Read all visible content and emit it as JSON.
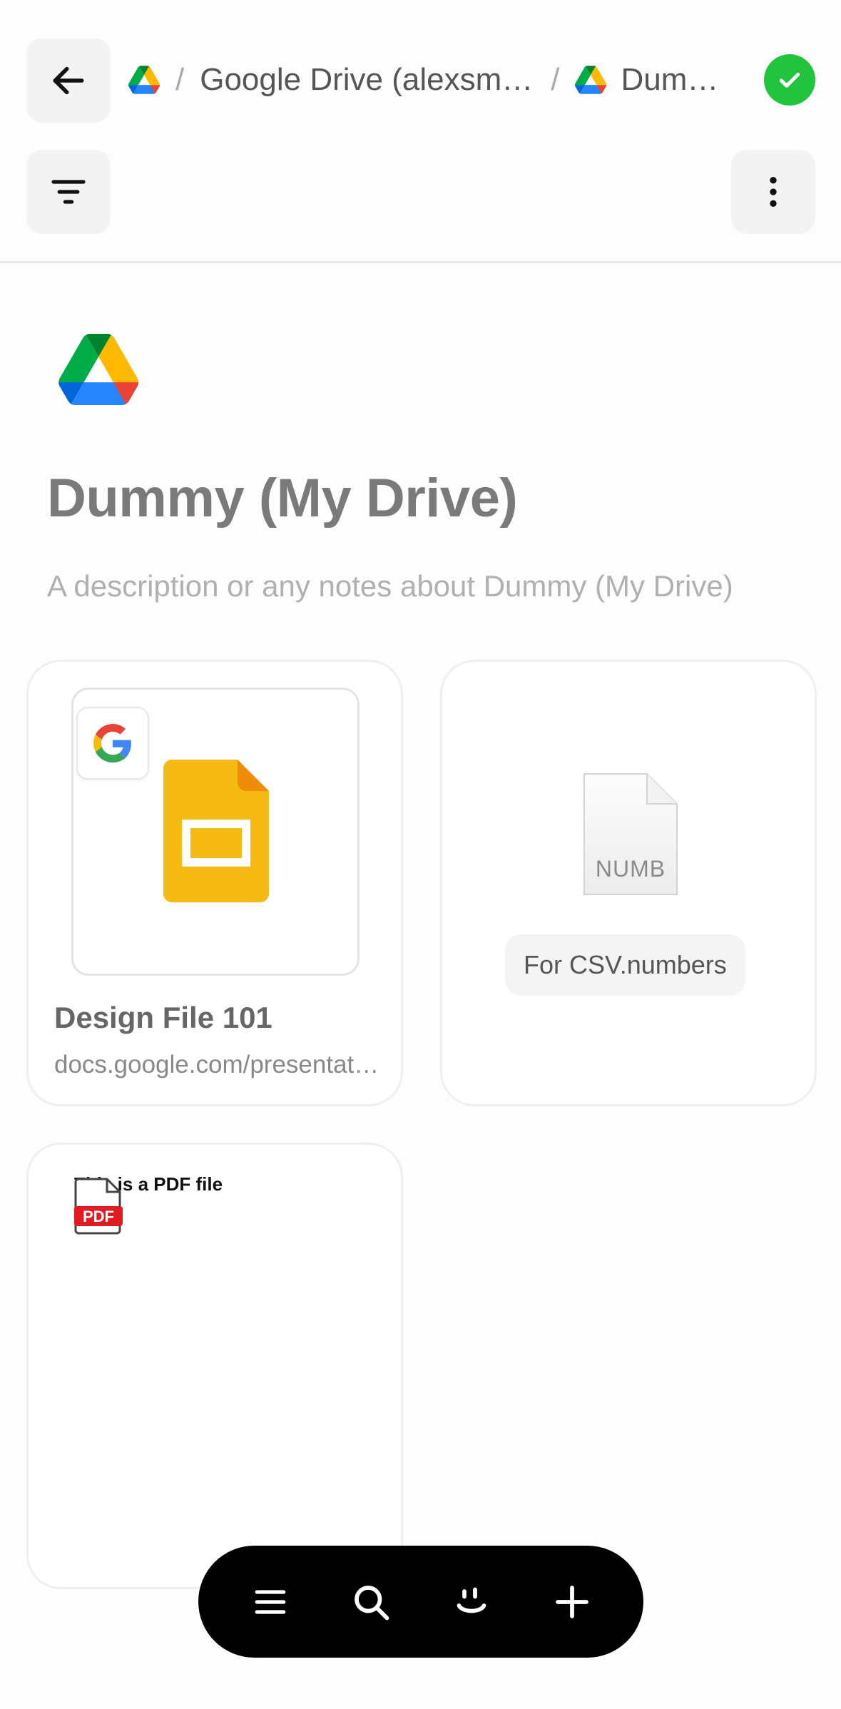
{
  "header": {
    "breadcrumbs": [
      {
        "label": "",
        "icon": "google-drive-icon"
      },
      {
        "label": "Google Drive (alexsmith.mobbin@gmail.com)",
        "icon": ""
      },
      {
        "label": "Dummy (My Drive)",
        "icon": "google-drive-icon"
      }
    ],
    "separator": "/",
    "status_icon": "check-circle-icon",
    "status_color": "#22c33d"
  },
  "page": {
    "title": "Dummy (My Drive)",
    "description_placeholder": "A description or any notes about Dummy (My Drive)"
  },
  "cards": [
    {
      "title": "Design File 101",
      "url": "docs.google.com/presentation",
      "icon": "google-slides-icon",
      "badge": "google-g-icon"
    },
    {
      "file_type_label": "NUMB",
      "chip_label": "For CSV.numbers",
      "icon": "numbers-file-icon"
    },
    {
      "preview_text": "This is a PDF file",
      "icon_label": "PDF",
      "icon": "pdf-icon"
    }
  ],
  "bottom_bar": {
    "items": [
      "menu-icon",
      "search-icon",
      "smile-icon",
      "plus-icon"
    ]
  }
}
